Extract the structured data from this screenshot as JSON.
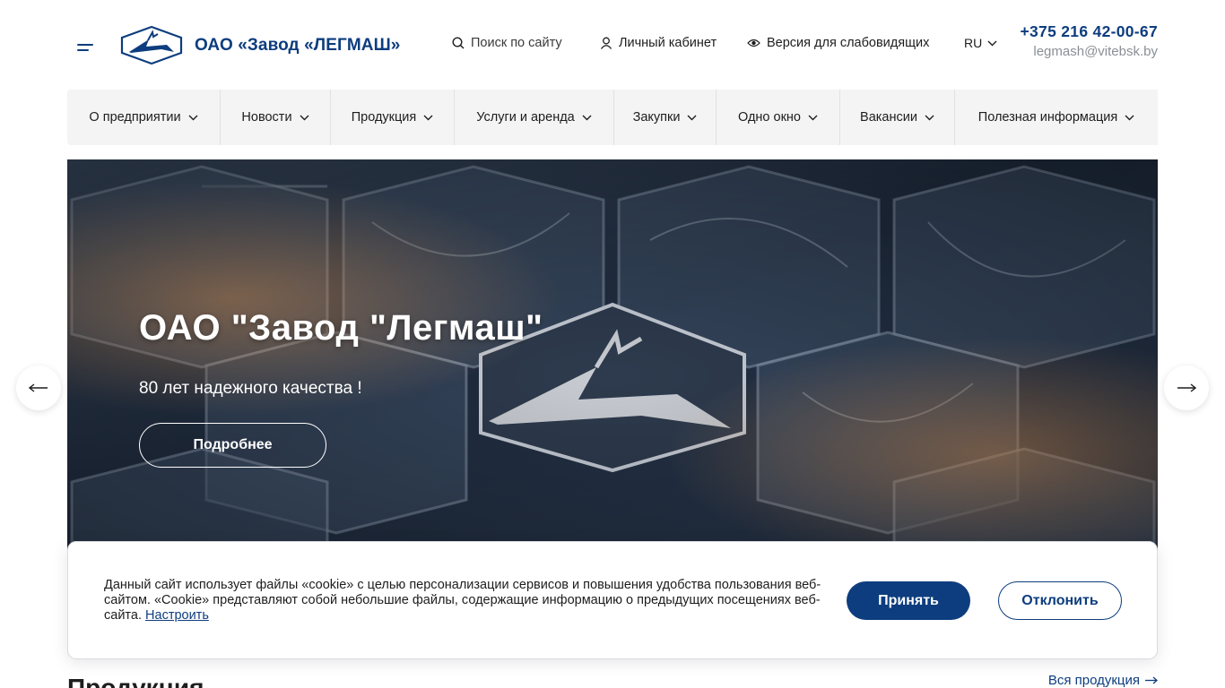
{
  "header": {
    "menu_icon": "burger-menu-icon",
    "logo_icon": "deer-emblem-icon",
    "logo_text": "ОАО «Завод «ЛЕГМАШ»",
    "search_label": "Поиск по сайту",
    "search_icon": "search-icon",
    "cabinet_label": "Личный кабинет",
    "cabinet_icon": "user-icon",
    "vision_label": "Версия для слабовидящих",
    "vision_icon": "eye-icon",
    "lang": "RU",
    "phone": "+375 216 42-00-67",
    "email": "legmash@vitebsk.by"
  },
  "nav": {
    "items": [
      {
        "label": "О предприятии"
      },
      {
        "label": "Новости"
      },
      {
        "label": "Продукция"
      },
      {
        "label": "Услуги и аренда"
      },
      {
        "label": "Закупки"
      },
      {
        "label": "Одно окно"
      },
      {
        "label": "Вакансии"
      },
      {
        "label": "Полезная информация"
      }
    ]
  },
  "hero": {
    "title": "ОАО \"Завод \"Легмаш\"",
    "subtitle": "80 лет надежного качества !",
    "button": "Подробнее",
    "prev_icon": "arrow-left-icon",
    "next_icon": "arrow-right-icon"
  },
  "products": {
    "title": "Продукция",
    "all_link": "Вся продукция"
  },
  "cookie": {
    "text": "Данный сайт использует файлы «cookie» с целью персонализации сервисов и повышения удобства пользования веб-сайтом. «Cookie» представляют собой небольшие файлы, содержащие информацию о предыдущих посещениях веб-сайта.",
    "settings_link": "Настроить",
    "accept": "Принять",
    "decline": "Отклонить"
  },
  "colors": {
    "brand": "#0d3d7e",
    "nav_bg": "#f4f4f5",
    "muted": "#8a8f96"
  }
}
